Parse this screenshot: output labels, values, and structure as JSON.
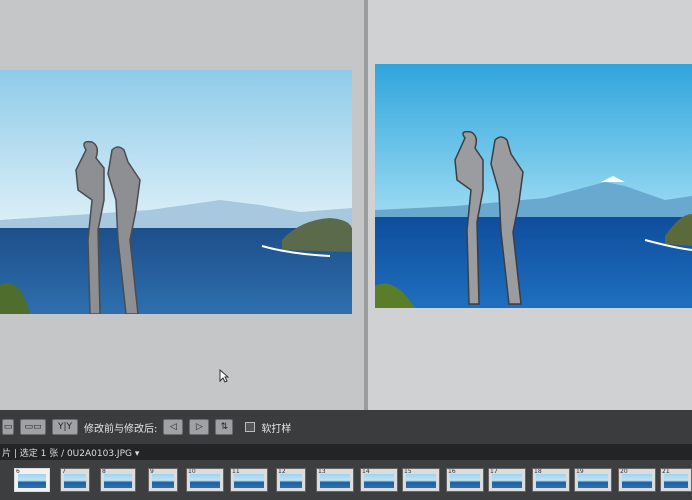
{
  "toolbar": {
    "view_buttons": [
      "▭",
      "▭▭"
    ],
    "swap_select": "Y|Y",
    "mode_label": "修改前与修改后:",
    "copy_left": "◁",
    "copy_right": "▷",
    "swap_icon": "⇅",
    "proof_label": "软打样"
  },
  "filmbar": {
    "status": "片 | 选定 1 张 / 0U2A0103.JPG ▾"
  },
  "filmstrip": {
    "numbers": [
      "6",
      "7",
      "8",
      "9",
      "10",
      "11",
      "12",
      "13",
      "14",
      "15",
      "16",
      "17",
      "18",
      "19",
      "20",
      "21"
    ]
  },
  "colors": {
    "toolbar_bg": "#3a3c3e",
    "film_bg": "#3c3e40",
    "sky": "#9fd3ef",
    "sea": "#1f5f9e"
  }
}
